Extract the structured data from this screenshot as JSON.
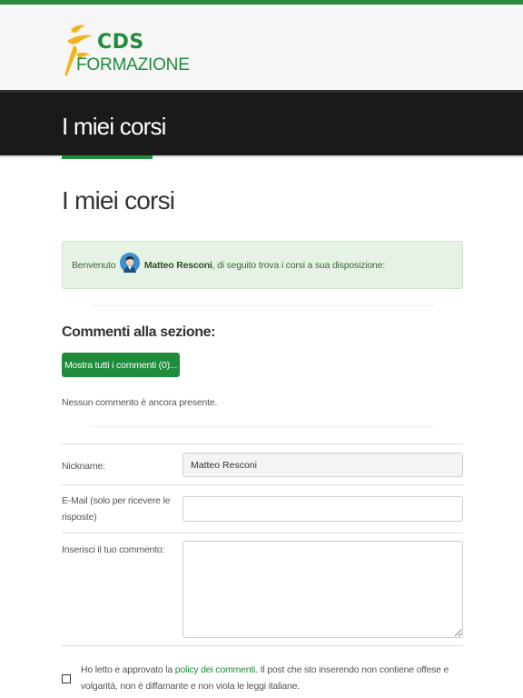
{
  "colors": {
    "brand_green": "#1e8c3a",
    "header_bg": "#f6f6f6",
    "banner_bg": "#1a1a1a",
    "welcome_bg": "#e6f2e3"
  },
  "logo": {
    "line1": "CDS",
    "line2": "FORMAZIONE",
    "mark_icon": "runner-logo-icon"
  },
  "banner": {
    "title": "I miei corsi"
  },
  "page": {
    "title": "I miei corsi"
  },
  "welcome": {
    "prefix": "Benvenuto",
    "avatar_icon": "user-avatar-icon",
    "name": "Matteo Resconi",
    "suffix": ", di seguito trova i corsi a sua disposizione:"
  },
  "comments": {
    "heading": "Commenti alla sezione:",
    "show_all_label": "Mostra tutti i commenti (0)...",
    "empty_text": "Nessun commento è ancora presente."
  },
  "form": {
    "nickname_label": "Nickname:",
    "nickname_value": "Matteo Resconi",
    "email_label": "E-Mail (solo per ricevere le risposte)",
    "email_value": "",
    "comment_label": "Inserisci il tuo commento:",
    "comment_value": "",
    "consent_prefix": "Ho letto e approvato la ",
    "consent_link": "policy dei commenti",
    "consent_suffix": ". Il post che sto inserendo non contiene offese e volgarità, non è diffamante e non viola le leggi italiane."
  }
}
